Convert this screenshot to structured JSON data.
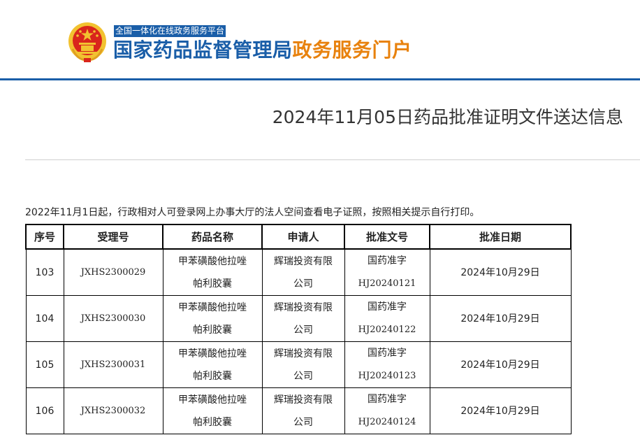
{
  "header": {
    "platform_label": "全国一体化在线政务服务平台",
    "title_main": "国家药品监督管理局",
    "title_accent": "政务服务门户",
    "colors": {
      "brand_blue": "#1a5ea8",
      "accent_orange": "#e8820e",
      "emblem_red": "#d9261c",
      "emblem_gold": "#f2c230"
    }
  },
  "page": {
    "title": "2024年11月05日药品批准证明文件送达信息",
    "notice": "2022年11月1日起，行政相对人可登录网上办事大厅的法人空间查看电子证照，按照相关提示自行打印。"
  },
  "table": {
    "headers": [
      "序号",
      "受理号",
      "药品名称",
      "申请人",
      "批准文号",
      "批准日期"
    ],
    "rows": [
      {
        "no": "103",
        "accept_no": "JXHS2300029",
        "drug_line1": "甲苯磺酸他拉唑",
        "drug_line2": "帕利胶囊",
        "applicant_line1": "辉瑞投资有限",
        "applicant_line2": "公司",
        "approval_line1": "国药准字",
        "approval_line2": "HJ20240121",
        "date": "2024年10月29日"
      },
      {
        "no": "104",
        "accept_no": "JXHS2300030",
        "drug_line1": "甲苯磺酸他拉唑",
        "drug_line2": "帕利胶囊",
        "applicant_line1": "辉瑞投资有限",
        "applicant_line2": "公司",
        "approval_line1": "国药准字",
        "approval_line2": "HJ20240122",
        "date": "2024年10月29日"
      },
      {
        "no": "105",
        "accept_no": "JXHS2300031",
        "drug_line1": "甲苯磺酸他拉唑",
        "drug_line2": "帕利胶囊",
        "applicant_line1": "辉瑞投资有限",
        "applicant_line2": "公司",
        "approval_line1": "国药准字",
        "approval_line2": "HJ20240123",
        "date": "2024年10月29日"
      },
      {
        "no": "106",
        "accept_no": "JXHS2300032",
        "drug_line1": "甲苯磺酸他拉唑",
        "drug_line2": "帕利胶囊",
        "applicant_line1": "辉瑞投资有限",
        "applicant_line2": "公司",
        "approval_line1": "国药准字",
        "approval_line2": "HJ20240124",
        "date": "2024年10月29日"
      }
    ]
  }
}
